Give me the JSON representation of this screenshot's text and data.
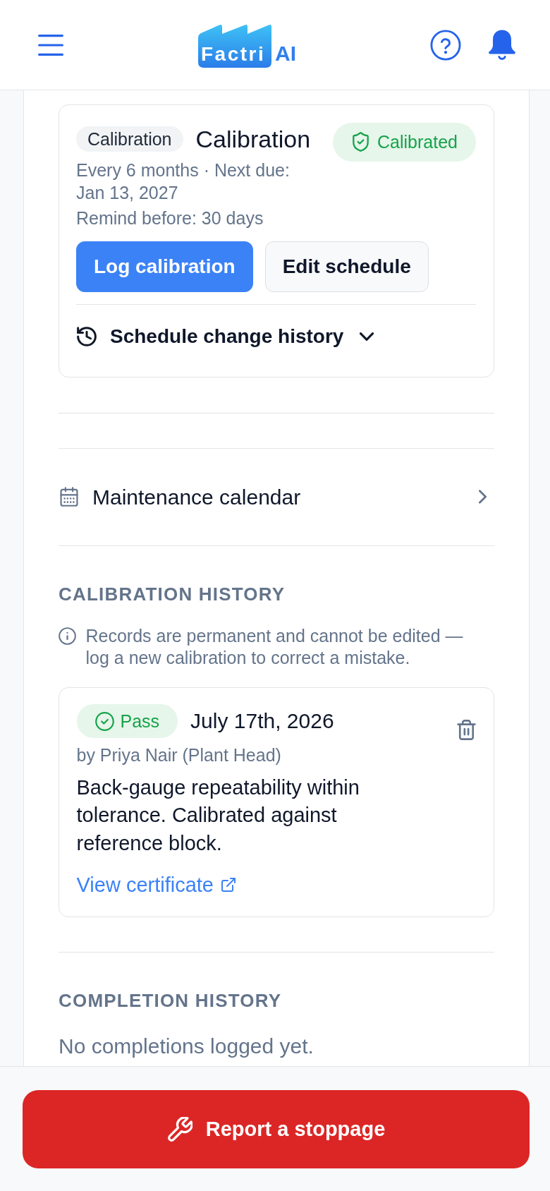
{
  "header": {
    "logo": {
      "badge_text": "Factri",
      "text": "AI"
    }
  },
  "schedule_card": {
    "chip": "Calibration",
    "title": "Calibration",
    "status": {
      "label": "Calibrated",
      "kind": "calibrated"
    },
    "meta": [
      "Every 6 months · Next due: Jan 13, 2027",
      "Remind before: 30 days"
    ],
    "buttons": [
      {
        "label": "Log calibration",
        "kind": "primary"
      },
      {
        "label": "Edit schedule",
        "kind": "secondary"
      }
    ],
    "history_toggle": {
      "label": "Schedule change history",
      "expanded": false
    }
  },
  "links": [
    {
      "label": "Maintenance calendar"
    }
  ],
  "calibration_history": {
    "heading": "CALIBRATION HISTORY",
    "note": "Records are permanent and cannot be edited — log a new calibration to correct a mistake.",
    "records": [
      {
        "result": {
          "label": "Pass",
          "kind": "pass"
        },
        "date": "July 17th, 2026",
        "author": "by Priya Nair (Plant Head)",
        "notes": "Back-gauge repeatability within tolerance. Calibrated against reference block.",
        "link": "View certificate"
      }
    ]
  },
  "completion_history": {
    "heading": "COMPLETION HISTORY",
    "empty_text": "No completions logged yet."
  },
  "action_button": {
    "label": "Report a stoppage"
  }
}
